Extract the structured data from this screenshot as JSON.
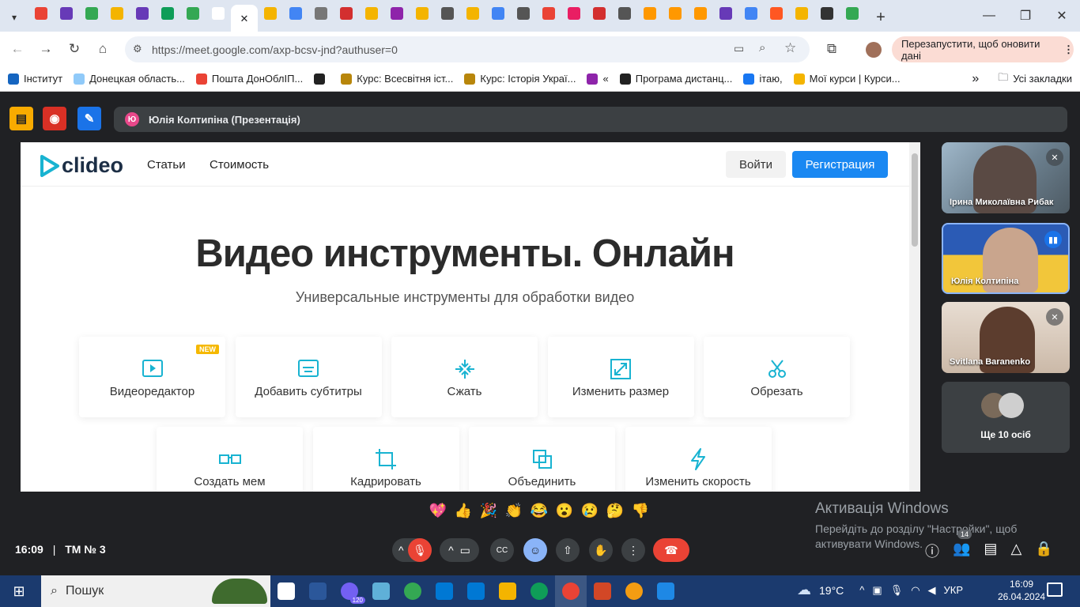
{
  "browser": {
    "url": "https://meet.google.com/axp-bcsv-jnd?authuser=0",
    "update_button": "Перезапустити, щоб оновити дані",
    "tab_favicon_colors": [
      "#ea4335",
      "#673ab7",
      "#34a853",
      "#f4b400",
      "#673ab7",
      "#0f9d58",
      "#34a853",
      "#ffffff",
      "#f4b400",
      "#f4b400",
      "#4285f4",
      "#777777",
      "#d32f2f",
      "#f4b400",
      "#8e24aa",
      "#f4b400",
      "#555555",
      "#f4b400",
      "#4285f4",
      "#555555",
      "#ea4335",
      "#e91e63",
      "#d32f2f",
      "#555555",
      "#ff9800",
      "#ff9800",
      "#ff9800",
      "#673ab7",
      "#4285f4",
      "#ff5722",
      "#f4b400",
      "#333333",
      "#34a853"
    ]
  },
  "bookmarks": {
    "items": [
      {
        "label": "Інститут",
        "color": "#1565c0"
      },
      {
        "label": "Донецкая область...",
        "color": "#90caf9"
      },
      {
        "label": "Пошта ДонОблІП...",
        "color": "#ea4335"
      },
      {
        "label": "",
        "color": "#222222"
      },
      {
        "label": "Курс: Всесвітня іст...",
        "color": "#b8860b"
      },
      {
        "label": "Курс: Історія Украї...",
        "color": "#b8860b"
      },
      {
        "label": "«",
        "color": "#8e24aa"
      },
      {
        "label": "Програма дистанц...",
        "color": "#222222"
      },
      {
        "label": "ітаю,",
        "color": "#1877f2"
      },
      {
        "label": "Мої курси | Курси...",
        "color": "#f4b400"
      }
    ],
    "chevron": "»",
    "all_bookmarks": "Усі закладки"
  },
  "meet": {
    "presenter_label": "Юлія Колтипіна (Презентація)",
    "presenter_initial": "Ю",
    "time": "16:09",
    "meeting_name": "ТМ № 3",
    "people_count": "14",
    "reactions": [
      "💖",
      "👍",
      "🎉",
      "👏",
      "😂",
      "😮",
      "😢",
      "🤔",
      "👎"
    ]
  },
  "presentation": {
    "logo": "clideo",
    "nav": [
      "Статьи",
      "Стоимость"
    ],
    "login": "Войти",
    "signup": "Регистрация",
    "headline": "Видео инструменты. Онлайн",
    "subheadline": "Универсальные инструменты для обработки видео",
    "accent_color": "#18b3d1",
    "tools_row1": [
      {
        "label": "Видеоредактор",
        "icon": "video-icon",
        "badge": "NEW"
      },
      {
        "label": "Добавить субтитры",
        "icon": "subtitles-icon"
      },
      {
        "label": "Сжать",
        "icon": "compress-icon"
      },
      {
        "label": "Изменить размер",
        "icon": "resize-icon"
      },
      {
        "label": "Обрезать",
        "icon": "scissors-icon"
      }
    ],
    "tools_row2": [
      {
        "label": "Создать мем",
        "icon": "glasses-icon"
      },
      {
        "label": "Кадрировать",
        "icon": "crop-icon"
      },
      {
        "label": "Объединить",
        "icon": "merge-icon"
      },
      {
        "label": "Изменить скорость",
        "icon": "lightning-icon"
      }
    ]
  },
  "participants": [
    {
      "name": "Ірина Миколаївна Рибак",
      "muted": true
    },
    {
      "name": "Юлія Колтипіна",
      "speaking": true
    },
    {
      "name": "Svitlana Baranenko",
      "muted": true
    }
  ],
  "more_participants": "Ще 10 осіб",
  "activation": {
    "title": "Активація Windows",
    "line1": "Перейдіть до розділу \"Настройки\", щоб",
    "line2": "активувати Windows."
  },
  "taskbar": {
    "search_placeholder": "Пошук",
    "viber_badge": "120",
    "temperature": "19°C",
    "language": "УКР",
    "clock_time": "16:09",
    "clock_date": "26.04.2024"
  }
}
